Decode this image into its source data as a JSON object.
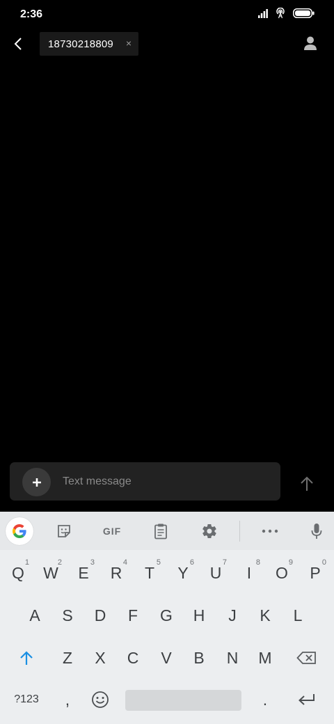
{
  "status_bar": {
    "time": "2:36"
  },
  "header": {
    "recipient": "18730218809",
    "chip_remove_glyph": "×"
  },
  "compose": {
    "placeholder": "Text message"
  },
  "keyboard": {
    "toolbar": {
      "gif_label": "GIF"
    },
    "row1": [
      {
        "label": "Q",
        "hint": "1"
      },
      {
        "label": "W",
        "hint": "2"
      },
      {
        "label": "E",
        "hint": "3"
      },
      {
        "label": "R",
        "hint": "4"
      },
      {
        "label": "T",
        "hint": "5"
      },
      {
        "label": "Y",
        "hint": "6"
      },
      {
        "label": "U",
        "hint": "7"
      },
      {
        "label": "I",
        "hint": "8"
      },
      {
        "label": "O",
        "hint": "9"
      },
      {
        "label": "P",
        "hint": "0"
      }
    ],
    "row2": [
      "A",
      "S",
      "D",
      "F",
      "G",
      "H",
      "J",
      "K",
      "L"
    ],
    "row3": [
      "Z",
      "X",
      "C",
      "V",
      "B",
      "N",
      "M"
    ],
    "row4": {
      "symbols_label": "?123",
      "comma": ",",
      "period": "."
    }
  },
  "colors": {
    "accent_blue": "#1a8fe3",
    "background": "#000000",
    "keyboard_bg": "#eceef0"
  }
}
